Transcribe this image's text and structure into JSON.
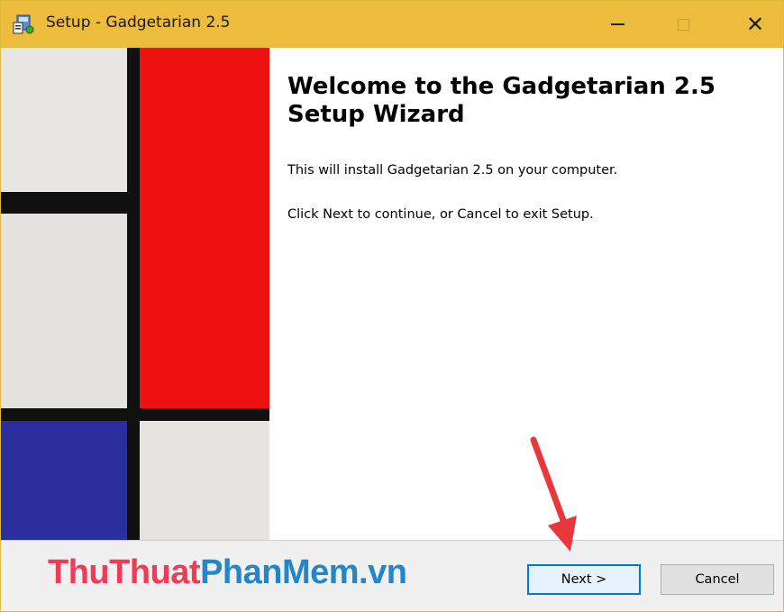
{
  "window": {
    "title": "Setup - Gadgetarian 2.5",
    "titlebar_color": "#ecbc3d",
    "controls": {
      "minimize_icon": "minimize-icon",
      "maximize_icon": "maximize-icon",
      "close_icon": "close-icon",
      "close_glyph": "✕"
    }
  },
  "wizard": {
    "heading": "Welcome to the Gadgetarian 2.5\nSetup Wizard",
    "install_text": "This will install Gadgetarian 2.5 on your computer.",
    "continue_text": "Click Next to continue, or Cancel to exit Setup.",
    "side_image": "mondrian-composition-image",
    "colors": {
      "red": "#ee1111",
      "blue": "#2b2f9e",
      "white": "#e6e3de",
      "black": "#101010"
    }
  },
  "footer": {
    "watermark_part1": "ThuThuat",
    "watermark_part2": "PhanMem.vn",
    "next_label": "Next >",
    "cancel_label": "Cancel"
  },
  "annotation": {
    "arrow_color": "#e8383c",
    "arrow_icon": "red-arrow-icon"
  }
}
